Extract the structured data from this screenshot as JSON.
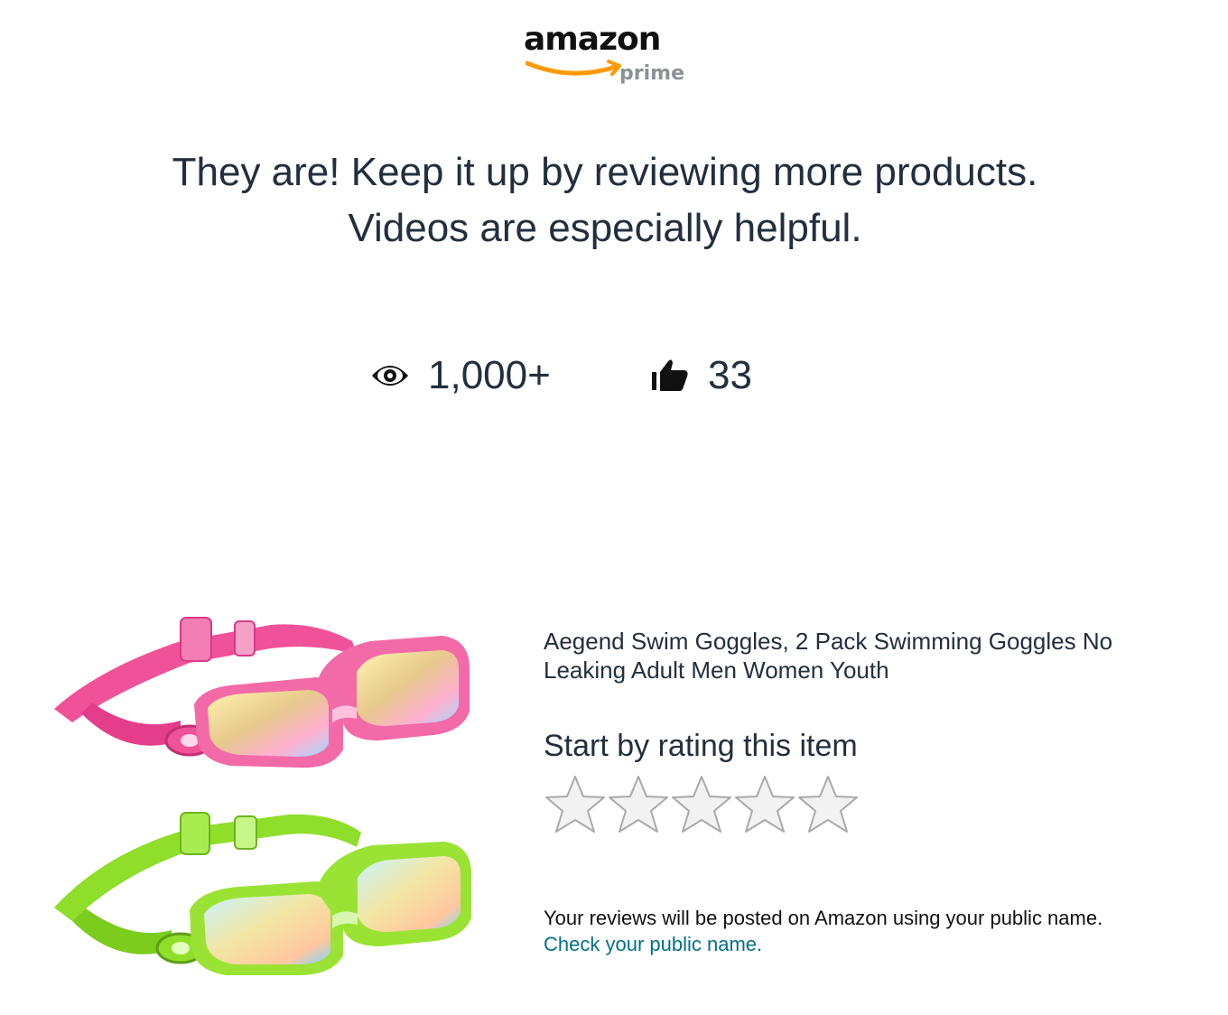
{
  "brand": {
    "wordmark": "amazon",
    "sub": "prime",
    "smile_color": "#ff9900",
    "sub_color": "#8d9096"
  },
  "headline": {
    "line1": "They are! Keep it up by reviewing more products.",
    "line2": "Videos are especially helpful."
  },
  "stats": {
    "views": {
      "icon": "eye-icon",
      "value": "1,000+"
    },
    "helpful": {
      "icon": "thumbs-up-icon",
      "value": "33"
    }
  },
  "product": {
    "title": "Aegend Swim Goggles, 2 Pack Swimming Goggles No Leaking Adult Men Women Youth",
    "image": "swim-goggles-pink-and-green",
    "colors": {
      "pink": "#f0529a",
      "green": "#8ede2a"
    }
  },
  "rating": {
    "label": "Start by rating this item",
    "max": 5,
    "selected": 0,
    "star_labels": [
      "1 star",
      "2 stars",
      "3 stars",
      "4 stars",
      "5 stars"
    ]
  },
  "footer": {
    "note": "Your reviews will be posted on Amazon using your public name.",
    "link": "Check your public name.",
    "link_color": "#007185"
  }
}
